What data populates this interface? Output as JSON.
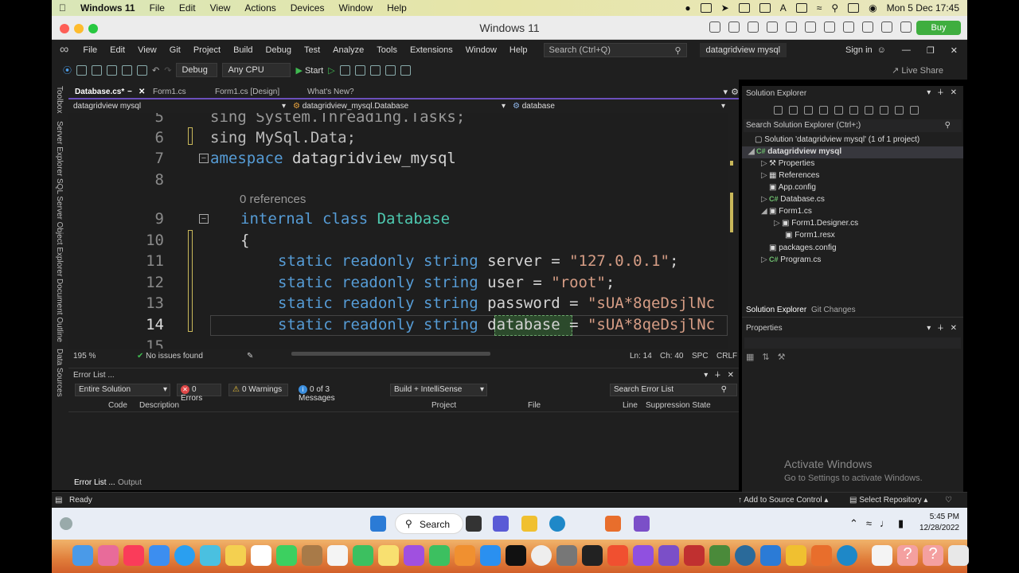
{
  "mac_menubar": {
    "app": "Windows 11",
    "items": [
      "File",
      "Edit",
      "View",
      "Actions",
      "Devices",
      "Window",
      "Help"
    ],
    "clock": "Mon 5 Dec  17:45"
  },
  "vm_window": {
    "title": "Windows 11",
    "buy_label": "Buy",
    "buy_color": "#3fae3f"
  },
  "vs_menu": {
    "items": [
      "File",
      "Edit",
      "View",
      "Git",
      "Project",
      "Build",
      "Debug",
      "Test",
      "Analyze",
      "Tools",
      "Extensions",
      "Window",
      "Help"
    ],
    "search_placeholder": "Search (Ctrl+Q)",
    "solution_name": "datagridview mysql",
    "sign_in": "Sign in"
  },
  "vs_toolbar": {
    "config": "Debug",
    "platform": "Any CPU",
    "start_label": "Start",
    "live_share": "Live Share"
  },
  "side_strip": {
    "items": [
      "Toolbox",
      "Server Explorer",
      "SQL Server Object Explorer",
      "Document Outline",
      "Data Sources"
    ]
  },
  "editor": {
    "tabs": [
      {
        "label": "Database.cs*",
        "active": true
      },
      {
        "label": "Form1.cs",
        "active": false
      },
      {
        "label": "Form1.cs [Design]",
        "active": false
      },
      {
        "label": "What's New?",
        "active": false
      }
    ],
    "nav": {
      "project": "datagridview mysql",
      "class": "datagridview_mysql.Database",
      "member": "database"
    },
    "references_label": "0 references",
    "lines": {
      "l5": {
        "num": "5",
        "text": "sing System.Threading.Tasks;"
      },
      "l6": {
        "num": "6",
        "text": "sing MySql.Data;"
      },
      "l7": {
        "num": "7",
        "kw": "amespace",
        "rest": " datagridview_mysql"
      },
      "l8": {
        "num": "8"
      },
      "l9": {
        "num": "9",
        "kw": "internal class",
        "type": "Database"
      },
      "l10": {
        "num": "10",
        "text": "{"
      },
      "l11": {
        "num": "11",
        "kw": "static readonly string",
        "name": "server",
        "eq": " = ",
        "str": "\"127.0.0.1\"",
        "end": ";"
      },
      "l12": {
        "num": "12",
        "kw": "static readonly string",
        "name": "user",
        "eq": " = ",
        "str": "\"root\"",
        "end": ";"
      },
      "l13": {
        "num": "13",
        "kw": "static readonly string",
        "name": "password",
        "eq": " = ",
        "str": "\"sUA*8qeDsjlNc",
        "end": ""
      },
      "l14": {
        "num": "14",
        "kw": "static readonly string",
        "name": "database",
        "eq": " = ",
        "str": "\"sUA*8qeDsjlNc",
        "end": ""
      },
      "l15": {
        "num": "15"
      }
    },
    "status": {
      "zoom": "195 %",
      "issues": "No issues found",
      "ln": "Ln: 14",
      "ch": "Ch: 40",
      "spc": "SPC",
      "crlf": "CRLF"
    }
  },
  "solution_explorer": {
    "title": "Solution Explorer",
    "search_placeholder": "Search Solution Explorer (Ctrl+;)",
    "solution": "Solution 'datagridview mysql' (1 of 1 project)",
    "project": "datagridview mysql",
    "items": {
      "properties": "Properties",
      "references": "References",
      "appconfig": "App.config",
      "database": "Database.cs",
      "form1": "Form1.cs",
      "form1designer": "Form1.Designer.cs",
      "form1resx": "Form1.resx",
      "packages": "packages.config",
      "program": "Program.cs"
    },
    "bottom_tabs": [
      "Solution Explorer",
      "Git Changes"
    ]
  },
  "properties_panel": {
    "title": "Properties",
    "activate_title": "Activate Windows",
    "activate_sub": "Go to Settings to activate Windows."
  },
  "error_list": {
    "title": "Error List ...",
    "scope": "Entire Solution",
    "errors": "0 Errors",
    "warnings": "0 Warnings",
    "messages": "0 of 3 Messages",
    "build_filter": "Build + IntelliSense",
    "search_placeholder": "Search Error List",
    "columns": [
      "Code",
      "Description",
      "Project",
      "File",
      "Line",
      "Suppression State"
    ],
    "bottom_tabs": [
      "Error List ...",
      "Output"
    ]
  },
  "vs_status": {
    "ready": "Ready",
    "source_control": "Add to Source Control",
    "repository": "Select Repository"
  },
  "taskbar": {
    "search": "Search",
    "time": "5:45 PM",
    "date": "12/28/2022"
  }
}
